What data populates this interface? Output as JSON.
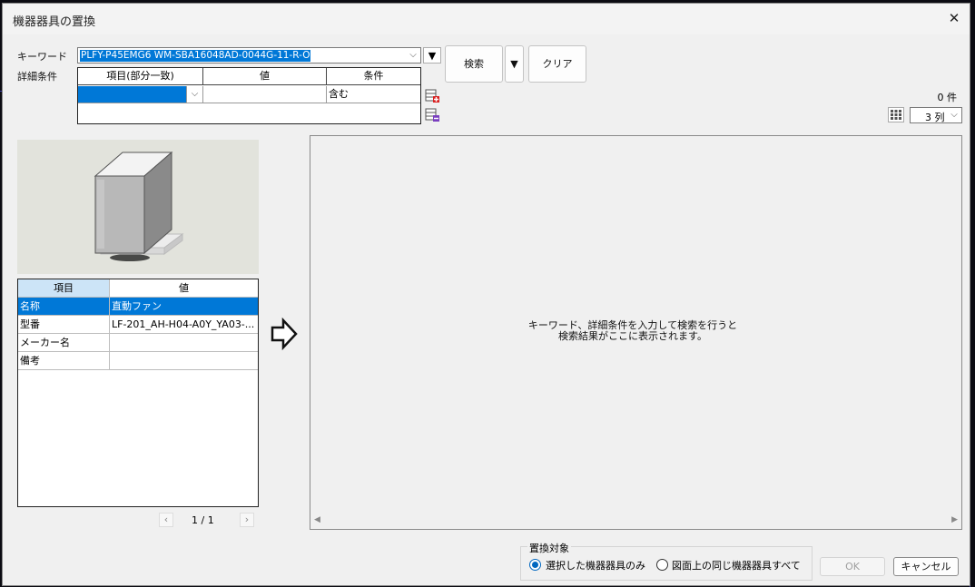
{
  "dialog": {
    "title": "機器器具の置換",
    "close_icon": "close-icon"
  },
  "keyword": {
    "label": "キーワード",
    "value": "PLFY-P45EMG6 WM-SBA16048AD-0044G-11-R-O"
  },
  "detail_conditions": {
    "label": "詳細条件",
    "headers": [
      "項目(部分一致)",
      "値",
      "条件"
    ],
    "row": {
      "item": "",
      "value": "",
      "condition": "含む"
    },
    "add_row_icon": "add-row-icon",
    "remove_row_icon": "remove-row-icon"
  },
  "toolbar": {
    "search_label": "検索",
    "search_menu_icon": "triangle-down-icon",
    "clear_label": "クリア"
  },
  "results": {
    "count": "0 件",
    "columns_value": "3 列",
    "grid_icon": "grid-icon",
    "empty_message_line1": "キーワード、詳細条件を入力して検索を行うと",
    "empty_message_line2": "検索結果がここに表示されます。"
  },
  "properties": {
    "headers": [
      "項目",
      "値"
    ],
    "rows": [
      {
        "item": "名称",
        "value": "直動ファン",
        "selected": true
      },
      {
        "item": "型番",
        "value": "LF-201_AH-H04-A0Y_YA03-...",
        "selected": false
      },
      {
        "item": "メーカー名",
        "value": "",
        "selected": false
      },
      {
        "item": "備考",
        "value": "",
        "selected": false
      }
    ]
  },
  "pager": {
    "text": "1 / 1",
    "prev_icon": "chevron-left-icon",
    "next_icon": "chevron-right-icon"
  },
  "replace_target": {
    "label": "置換対象",
    "options": [
      {
        "label": "選択した機器器具のみ",
        "checked": true
      },
      {
        "label": "図面上の同じ機器器具すべて",
        "checked": false
      }
    ]
  },
  "buttons": {
    "ok_label": "OK",
    "cancel_label": "キャンセル"
  },
  "colors": {
    "accent": "#0078d7",
    "selection": "#0078d7",
    "header_highlight": "#cce4f7"
  }
}
